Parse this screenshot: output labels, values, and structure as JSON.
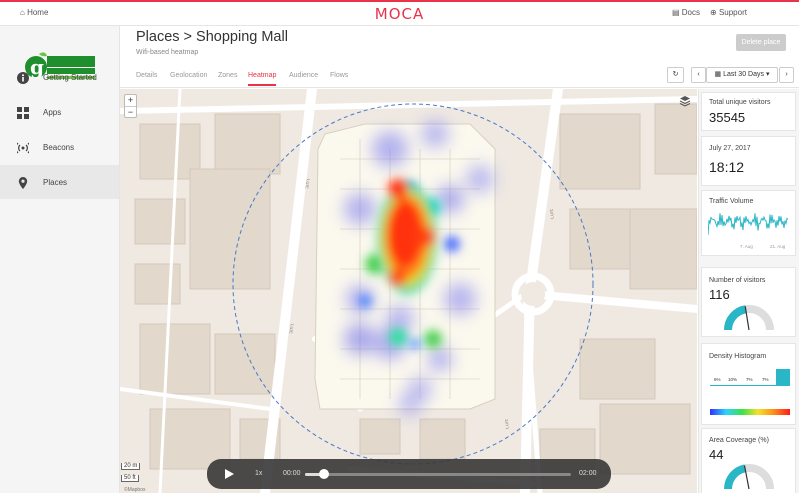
{
  "topbar": {
    "home_label": "Home",
    "brand": "MOCA",
    "docs_label": "Docs",
    "support_label": "Support"
  },
  "logo": {
    "brand_text": "GREENS FOOD SUPPLIERS",
    "brand_color": "#1e8f2c"
  },
  "sidebar": {
    "items": [
      {
        "label": "Getting Started",
        "icon": "info-icon"
      },
      {
        "label": "Apps",
        "icon": "grid-icon"
      },
      {
        "label": "Beacons",
        "icon": "broadcast-icon"
      },
      {
        "label": "Places",
        "icon": "map-pin-icon",
        "active": true
      }
    ]
  },
  "header": {
    "title": "Places > Shopping Mall",
    "subtitle": "Wifi-based heatmap",
    "delete_label": "Delete place",
    "tabs": [
      "Details",
      "Geolocation",
      "Zones",
      "Heatmap",
      "Audience",
      "Flows"
    ],
    "active_tab": "Heatmap",
    "date_range": "Last 30 Days"
  },
  "map": {
    "zoom_in": "+",
    "zoom_out": "−",
    "scale_m": "20 m",
    "scale_ft": "50 ft",
    "attribution": "©Mapbox",
    "street_label": "רחוב"
  },
  "player": {
    "speed": "1x",
    "current_time": "00:00",
    "end_time": "02:00",
    "progress": 0.07
  },
  "stats": {
    "unique_label": "Total unique visitors",
    "unique_value": "35545",
    "date": "July 27, 2017",
    "time": "18:12",
    "traffic_label": "Traffic Volume",
    "traffic_tick_1": "7. Aug",
    "traffic_tick_2": "21. Aug",
    "visitors_label": "Number of visitors",
    "visitors_value": "116",
    "visitors_gauge": 0.45,
    "density_label": "Density Histogram",
    "density_bins": [
      "6%",
      "10%",
      "7%",
      "7%"
    ],
    "coverage_label": "Area Coverage (%)",
    "coverage_value": "44",
    "coverage_gauge": 0.44
  },
  "colors": {
    "accent": "#e8334a",
    "teal": "#29b6c6"
  }
}
